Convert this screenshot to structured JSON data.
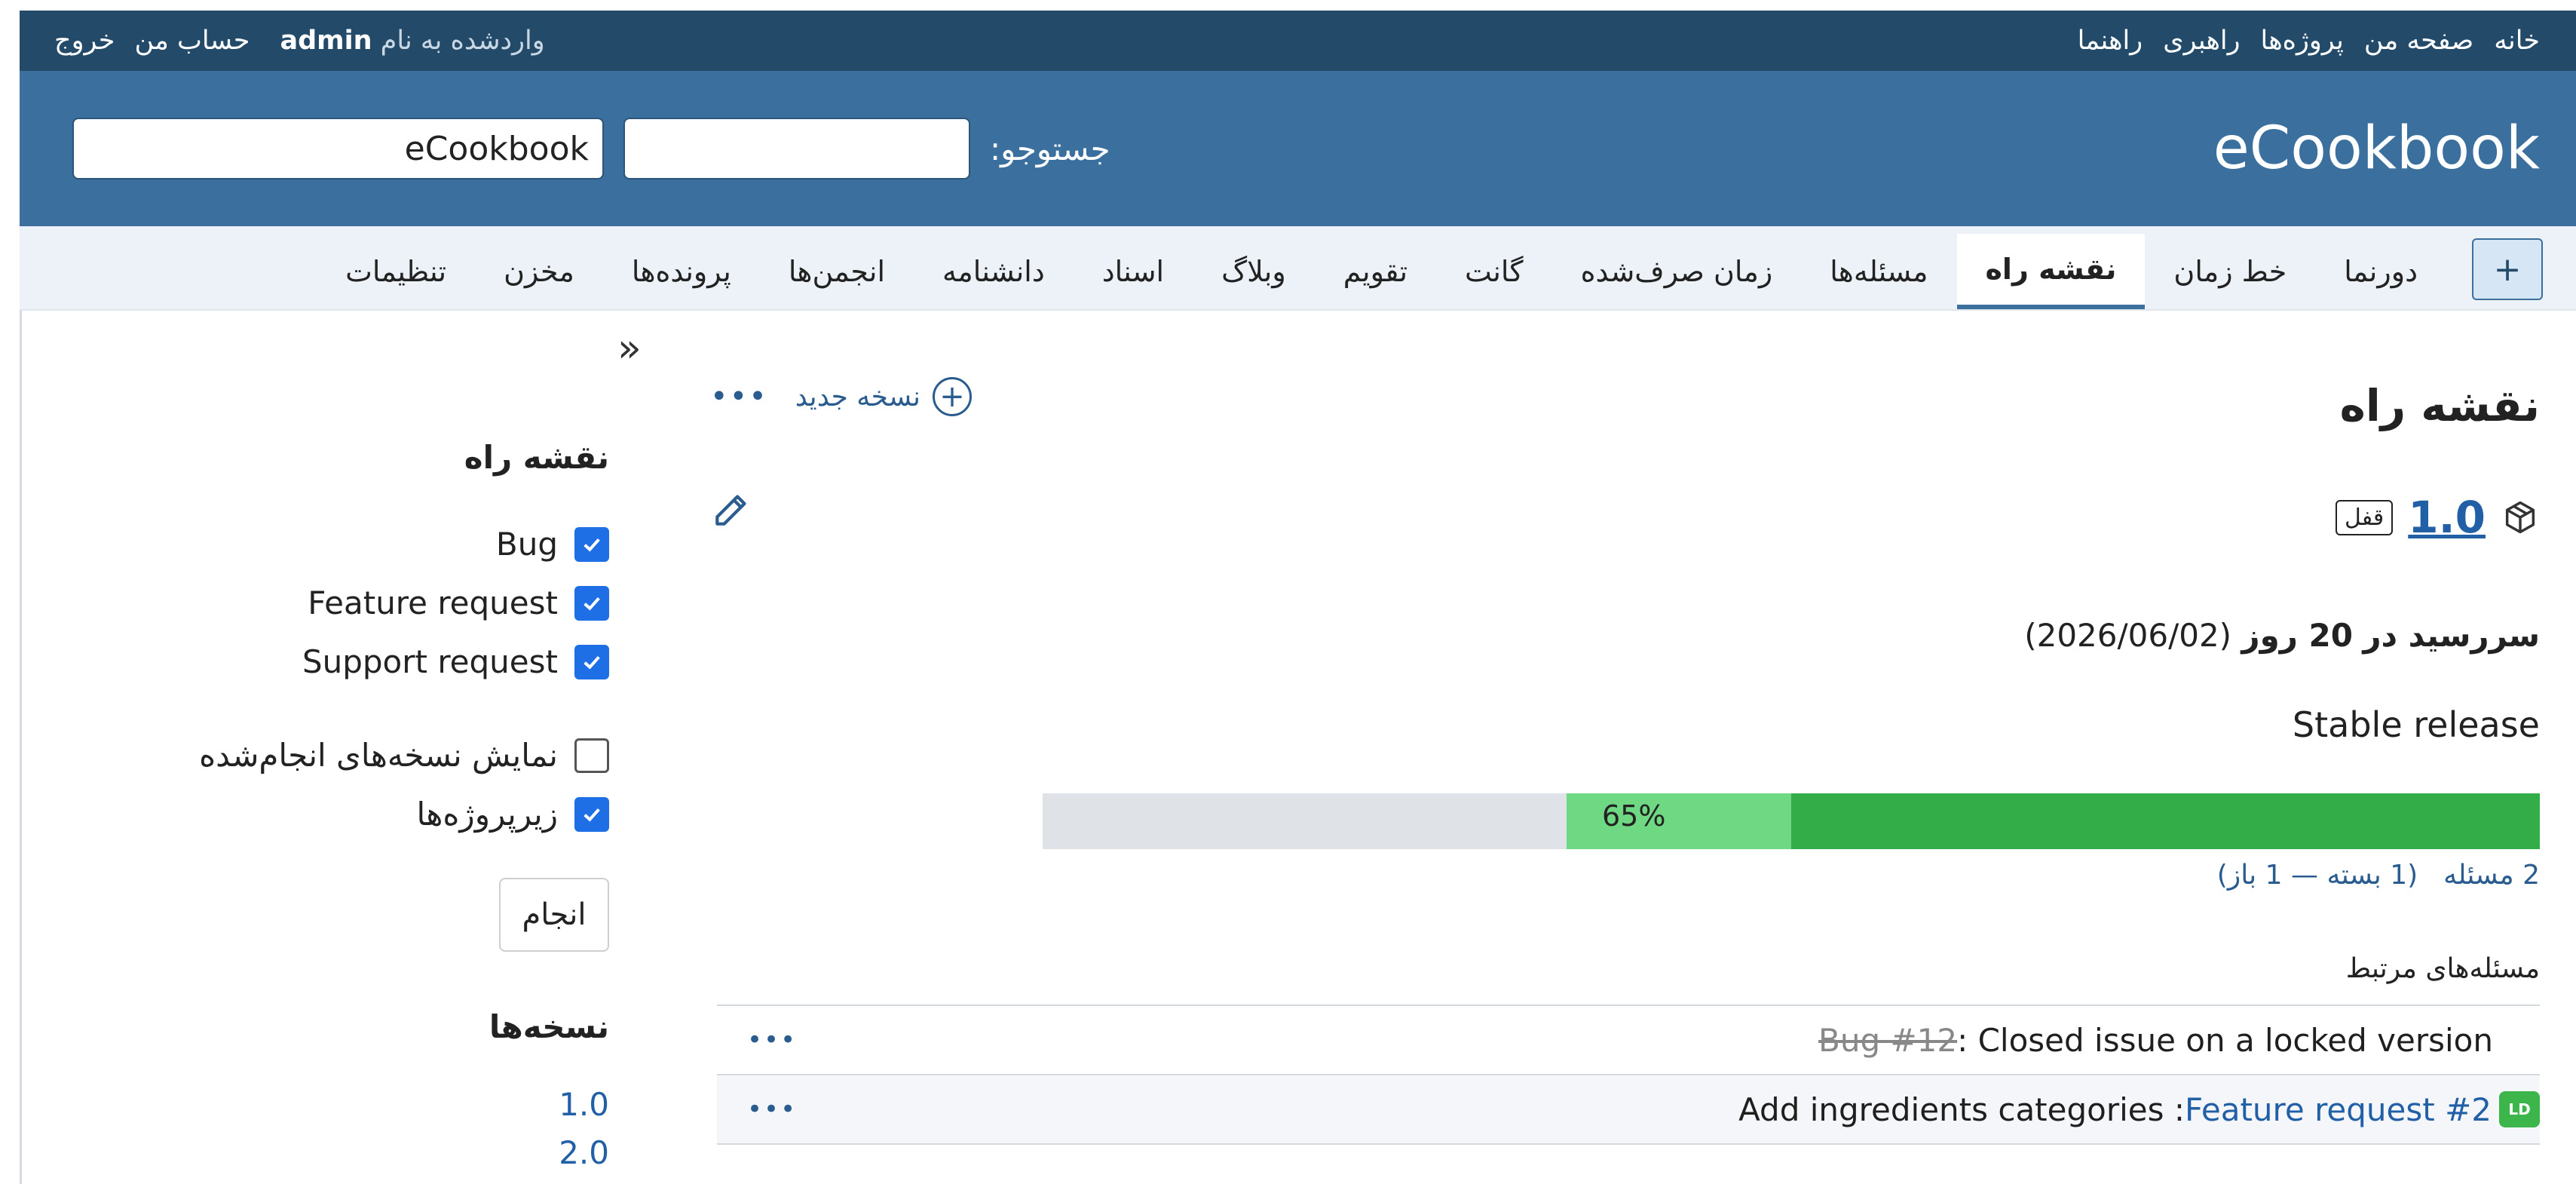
{
  "topbar": {
    "menu": [
      "خانه",
      "صفحه من",
      "پروژه‌ها",
      "راهبری",
      "راهنما"
    ],
    "logged_prefix": "واردشده به نام",
    "logged_user": "admin",
    "my_account": "حساب من",
    "logout": "خروج"
  },
  "header": {
    "title": "eCookbook",
    "search_label": "جستوجو:",
    "search_value": "",
    "project_value": "eCookbook"
  },
  "tabs": {
    "new_icon": "+",
    "items": [
      "دورنما",
      "خط زمان",
      "نقشه راه",
      "مسئله‌ها",
      "زمان صرف‌شده",
      "گانت",
      "تقویم",
      "وبلاگ",
      "اسناد",
      "دانشنامه",
      "انجمن‌ها",
      "پرونده‌ها",
      "مخزن",
      "تنظیمات"
    ],
    "selected": "نقشه راه"
  },
  "main": {
    "title": "نقشه راه",
    "new_version": "نسخه جدید",
    "more": "•••",
    "version_name": "1.0",
    "version_status": "قفل",
    "due_prefix": "سررسید در",
    "due_days": "20 روز",
    "due_date": "(2026/06/02)",
    "description": "Stable release",
    "progress": {
      "closed_percent": 50,
      "done_percent": 65,
      "label": "65%"
    },
    "issue_count": "2 مسئله",
    "issue_breakdown": "(1 بسته — 1 باز)",
    "related_title": "مسئله‌های مرتبط",
    "issues": [
      {
        "id": "Bug #12",
        "subject": ": Closed issue on a locked version",
        "closed": true
      },
      {
        "id": "Feature request #2",
        "subject": ": Add ingredients categories",
        "badge": "LD",
        "closed": false
      }
    ]
  },
  "sidebar": {
    "collapse_icon": "«",
    "roadmap_title": "نقشه راه",
    "trackers": [
      {
        "label": "Bug",
        "checked": true
      },
      {
        "label": "Feature request",
        "checked": true
      },
      {
        "label": "Support request",
        "checked": true
      }
    ],
    "show_completed": "نمایش نسخه‌های انجام‌شده",
    "subprojects": "زیرپروژه‌ها",
    "apply": "انجام",
    "versions_title": "نسخه‌ها",
    "versions": [
      "1.0",
      "2.0"
    ]
  },
  "colors": {
    "topbar": "#234a69",
    "header": "#3a6f9e",
    "progress_closed": "#32ad48",
    "progress_open": "#6fd883",
    "link": "#2160a6"
  }
}
